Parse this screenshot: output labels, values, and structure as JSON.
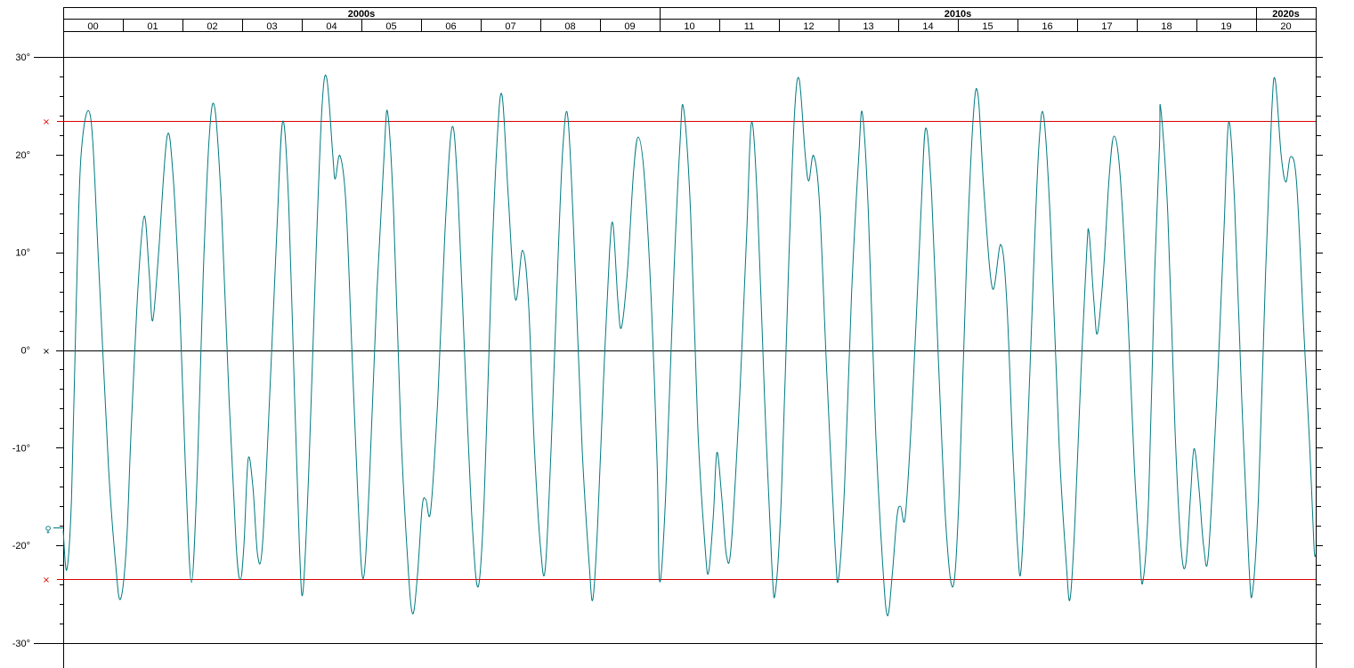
{
  "chart_data": {
    "type": "line",
    "title": "",
    "xlabel": "",
    "ylabel": "",
    "x_range": [
      2000,
      2021
    ],
    "ylim": [
      -30,
      30
    ],
    "y_ticks": [
      30,
      20,
      10,
      0,
      -10,
      -20,
      -30
    ],
    "y_tick_labels": [
      "30°",
      "20°",
      "10°",
      "0°",
      "-10°",
      "-20°",
      "-30°"
    ],
    "decades": [
      {
        "label": "2000s",
        "start": 2000,
        "end": 2010
      },
      {
        "label": "2010s",
        "start": 2010,
        "end": 2020
      },
      {
        "label": "2020s",
        "start": 2020,
        "end": 2021
      }
    ],
    "year_labels": [
      "00",
      "01",
      "02",
      "03",
      "04",
      "05",
      "06",
      "07",
      "08",
      "09",
      "10",
      "11",
      "12",
      "13",
      "14",
      "15",
      "16",
      "17",
      "18",
      "19",
      "20"
    ],
    "reference_lines": [
      {
        "y": 23.44,
        "color": "#dd0000",
        "marker": "×"
      },
      {
        "y": 0,
        "color": "#000000",
        "marker": "×"
      },
      {
        "y": -23.44,
        "color": "#dd0000",
        "marker": "×"
      }
    ],
    "start_marker": {
      "symbol": "♀",
      "y": -18.2,
      "color": "#007a80"
    },
    "series": [
      {
        "color": "#007a80",
        "points": [
          [
            2000.0,
            -18.5
          ],
          [
            2000.06,
            -22.5
          ],
          [
            2000.14,
            -15
          ],
          [
            2000.22,
            5
          ],
          [
            2000.3,
            20
          ],
          [
            2000.46,
            23.8
          ],
          [
            2000.6,
            8
          ],
          [
            2000.76,
            -12
          ],
          [
            2000.88,
            -22
          ],
          [
            2000.96,
            -25.5
          ],
          [
            2001.06,
            -20
          ],
          [
            2001.14,
            -8
          ],
          [
            2001.26,
            7
          ],
          [
            2001.36,
            13.7
          ],
          [
            2001.44,
            8
          ],
          [
            2001.5,
            3
          ],
          [
            2001.6,
            10
          ],
          [
            2001.74,
            21.8
          ],
          [
            2001.84,
            18
          ],
          [
            2001.95,
            5
          ],
          [
            2002.05,
            -12
          ],
          [
            2002.15,
            -23.8
          ],
          [
            2002.25,
            -12
          ],
          [
            2002.35,
            8
          ],
          [
            2002.45,
            22
          ],
          [
            2002.54,
            24.8
          ],
          [
            2002.65,
            15
          ],
          [
            2002.78,
            -5
          ],
          [
            2002.9,
            -20
          ],
          [
            2002.97,
            -23.5
          ],
          [
            2003.03,
            -20
          ],
          [
            2003.1,
            -11.2
          ],
          [
            2003.18,
            -14
          ],
          [
            2003.26,
            -21
          ],
          [
            2003.34,
            -20
          ],
          [
            2003.46,
            -5
          ],
          [
            2003.58,
            12
          ],
          [
            2003.68,
            23.4
          ],
          [
            2003.78,
            15
          ],
          [
            2003.88,
            -5
          ],
          [
            2003.96,
            -20
          ],
          [
            2004.02,
            -24.8
          ],
          [
            2004.12,
            -12
          ],
          [
            2004.24,
            10
          ],
          [
            2004.34,
            25
          ],
          [
            2004.42,
            27.8
          ],
          [
            2004.52,
            20
          ],
          [
            2004.56,
            17.5
          ],
          [
            2004.64,
            19.9
          ],
          [
            2004.74,
            15
          ],
          [
            2004.84,
            0
          ],
          [
            2004.94,
            -15
          ],
          [
            2005.03,
            -23.4
          ],
          [
            2005.13,
            -14
          ],
          [
            2005.26,
            6
          ],
          [
            2005.38,
            20
          ],
          [
            2005.44,
            24.3
          ],
          [
            2005.54,
            14
          ],
          [
            2005.66,
            -8
          ],
          [
            2005.78,
            -22
          ],
          [
            2005.86,
            -27
          ],
          [
            2005.94,
            -23
          ],
          [
            2006.02,
            -16
          ],
          [
            2006.08,
            -15.3
          ],
          [
            2006.16,
            -16.5
          ],
          [
            2006.28,
            -5
          ],
          [
            2006.4,
            12
          ],
          [
            2006.52,
            22.8
          ],
          [
            2006.62,
            16
          ],
          [
            2006.74,
            -2
          ],
          [
            2006.86,
            -18
          ],
          [
            2006.96,
            -24.2
          ],
          [
            2007.06,
            -15
          ],
          [
            2007.18,
            8
          ],
          [
            2007.28,
            22
          ],
          [
            2007.36,
            26
          ],
          [
            2007.46,
            16
          ],
          [
            2007.58,
            5.2
          ],
          [
            2007.7,
            10.2
          ],
          [
            2007.8,
            5
          ],
          [
            2007.9,
            -10
          ],
          [
            2008.0,
            -20
          ],
          [
            2008.08,
            -22.5
          ],
          [
            2008.18,
            -10
          ],
          [
            2008.3,
            10
          ],
          [
            2008.38,
            21
          ],
          [
            2008.46,
            23.9
          ],
          [
            2008.56,
            12
          ],
          [
            2008.7,
            -10
          ],
          [
            2008.82,
            -22
          ],
          [
            2008.88,
            -25.5
          ],
          [
            2008.96,
            -18
          ],
          [
            2009.06,
            -3
          ],
          [
            2009.16,
            10
          ],
          [
            2009.22,
            12.8
          ],
          [
            2009.3,
            5
          ],
          [
            2009.36,
            2.3
          ],
          [
            2009.46,
            8
          ],
          [
            2009.56,
            18
          ],
          [
            2009.64,
            21.8
          ],
          [
            2009.74,
            18
          ],
          [
            2009.86,
            5
          ],
          [
            2009.96,
            -12
          ],
          [
            2010.0,
            -23.7
          ],
          [
            2010.1,
            -15
          ],
          [
            2010.24,
            8
          ],
          [
            2010.34,
            21
          ],
          [
            2010.4,
            24.8
          ],
          [
            2010.52,
            14
          ],
          [
            2010.64,
            -8
          ],
          [
            2010.76,
            -20
          ],
          [
            2010.82,
            -22.8
          ],
          [
            2010.9,
            -17
          ],
          [
            2010.96,
            -10.5
          ],
          [
            2011.04,
            -15
          ],
          [
            2011.12,
            -21
          ],
          [
            2011.2,
            -20
          ],
          [
            2011.34,
            -5
          ],
          [
            2011.46,
            12
          ],
          [
            2011.54,
            23.3
          ],
          [
            2011.64,
            15
          ],
          [
            2011.76,
            -5
          ],
          [
            2011.88,
            -22
          ],
          [
            2011.94,
            -24.8
          ],
          [
            2012.04,
            -15
          ],
          [
            2012.16,
            8
          ],
          [
            2012.26,
            24
          ],
          [
            2012.34,
            27.7
          ],
          [
            2012.44,
            20
          ],
          [
            2012.5,
            17.3
          ],
          [
            2012.58,
            19.9
          ],
          [
            2012.68,
            15
          ],
          [
            2012.8,
            -2
          ],
          [
            2012.94,
            -20
          ],
          [
            2013.0,
            -23.4
          ],
          [
            2013.1,
            -14
          ],
          [
            2013.22,
            6
          ],
          [
            2013.34,
            20
          ],
          [
            2013.4,
            24.2
          ],
          [
            2013.5,
            14
          ],
          [
            2013.62,
            -8
          ],
          [
            2013.74,
            -22
          ],
          [
            2013.82,
            -27.2
          ],
          [
            2013.9,
            -23
          ],
          [
            2013.98,
            -17
          ],
          [
            2014.04,
            -16
          ],
          [
            2014.12,
            -17
          ],
          [
            2014.24,
            -5
          ],
          [
            2014.38,
            14
          ],
          [
            2014.46,
            22.7
          ],
          [
            2014.56,
            16
          ],
          [
            2014.68,
            -2
          ],
          [
            2014.8,
            -18
          ],
          [
            2014.92,
            -24.2
          ],
          [
            2015.02,
            -15
          ],
          [
            2015.14,
            8
          ],
          [
            2015.26,
            24
          ],
          [
            2015.34,
            26
          ],
          [
            2015.44,
            16
          ],
          [
            2015.58,
            6.3
          ],
          [
            2015.72,
            10.8
          ],
          [
            2015.82,
            5
          ],
          [
            2015.92,
            -10
          ],
          [
            2016.0,
            -20
          ],
          [
            2016.06,
            -22.5
          ],
          [
            2016.16,
            -10
          ],
          [
            2016.28,
            10
          ],
          [
            2016.36,
            21
          ],
          [
            2016.44,
            23.9
          ],
          [
            2016.56,
            12
          ],
          [
            2016.7,
            -10
          ],
          [
            2016.82,
            -22
          ],
          [
            2016.88,
            -25.5
          ],
          [
            2016.96,
            -18
          ],
          [
            2017.06,
            -3
          ],
          [
            2017.16,
            10
          ],
          [
            2017.2,
            12
          ],
          [
            2017.28,
            5
          ],
          [
            2017.34,
            1.7
          ],
          [
            2017.44,
            8
          ],
          [
            2017.54,
            18
          ],
          [
            2017.62,
            21.9
          ],
          [
            2017.72,
            18
          ],
          [
            2017.84,
            5
          ],
          [
            2017.96,
            -12
          ],
          [
            2018.04,
            -20
          ],
          [
            2018.1,
            -23.8
          ],
          [
            2018.2,
            -15
          ],
          [
            2018.3,
            8
          ],
          [
            2018.38,
            21
          ],
          [
            2018.4,
            24.8
          ],
          [
            2018.52,
            14
          ],
          [
            2018.64,
            -8
          ],
          [
            2018.74,
            -20
          ],
          [
            2018.82,
            -22
          ],
          [
            2018.9,
            -15
          ],
          [
            2018.96,
            -10.1
          ],
          [
            2019.04,
            -14
          ],
          [
            2019.12,
            -20
          ],
          [
            2019.2,
            -21
          ],
          [
            2019.34,
            -5
          ],
          [
            2019.46,
            12
          ],
          [
            2019.54,
            23.3
          ],
          [
            2019.64,
            15
          ],
          [
            2019.76,
            -5
          ],
          [
            2019.88,
            -22
          ],
          [
            2019.94,
            -24.8
          ],
          [
            2020.04,
            -15
          ],
          [
            2020.16,
            8
          ],
          [
            2020.26,
            24
          ],
          [
            2020.32,
            27.7
          ],
          [
            2020.42,
            20
          ],
          [
            2020.5,
            17.2
          ],
          [
            2020.58,
            19.8
          ],
          [
            2020.68,
            17
          ],
          [
            2020.8,
            2
          ],
          [
            2020.9,
            -10
          ],
          [
            2020.97,
            -20
          ],
          [
            2021.0,
            -21
          ]
        ]
      }
    ]
  }
}
